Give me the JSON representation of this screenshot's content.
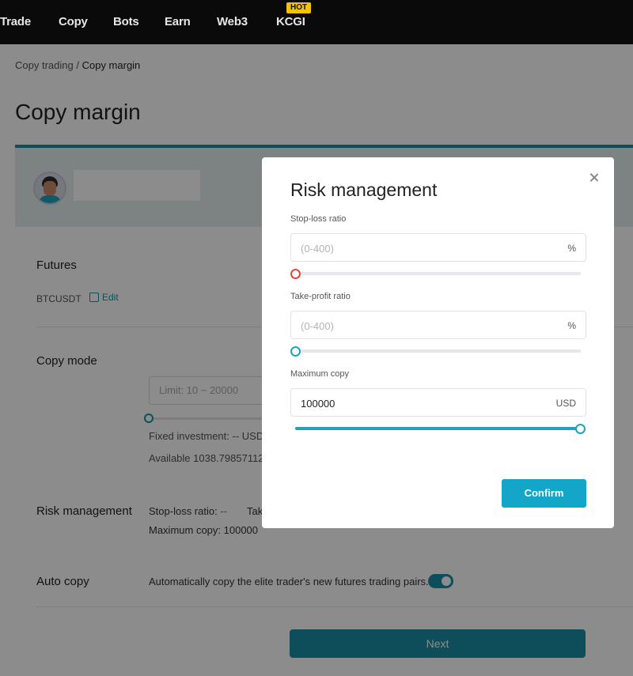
{
  "nav": {
    "items": [
      "Trade",
      "Copy",
      "Bots",
      "Earn",
      "Web3",
      "KCGI"
    ],
    "hot_badge": "HOT"
  },
  "breadcrumb": {
    "parent": "Copy trading",
    "separator": "/",
    "current": "Copy margin"
  },
  "page_title": "Copy margin",
  "futures": {
    "label": "Futures",
    "pair": "BTCUSDT",
    "edit_label": "Edit"
  },
  "copy_mode": {
    "label": "Copy mode",
    "limit_placeholder": "Limit: 10 ~ 20000",
    "fixed_investment": "Fixed investment: -- USDT",
    "available": "Available 1038.79857112"
  },
  "risk_management_summary": {
    "label": "Risk management",
    "stop_loss_prefix": "Stop-loss ratio:",
    "stop_loss_value": "--",
    "take_profit_partial": "Tak",
    "max_copy": "Maximum copy: 100000"
  },
  "auto_copy": {
    "label": "Auto copy",
    "description": "Automatically copy the elite trader's new futures trading pairs.",
    "enabled": true
  },
  "next_label": "Next",
  "modal": {
    "title": "Risk management",
    "stop_loss": {
      "label": "Stop-loss ratio",
      "placeholder": "(0-400)",
      "unit": "%",
      "slider_value": 0
    },
    "take_profit": {
      "label": "Take-profit ratio",
      "placeholder": "(0-400)",
      "unit": "%",
      "slider_value": 0
    },
    "max_copy": {
      "label": "Maximum copy",
      "value": "100000",
      "unit": "USD",
      "slider_value": 1.0
    },
    "confirm_label": "Confirm"
  },
  "colors": {
    "accent": "#13a6c9",
    "danger": "#e04a3a",
    "nav_bg": "#0a0a0a",
    "hot_badge": "#f3c200"
  }
}
